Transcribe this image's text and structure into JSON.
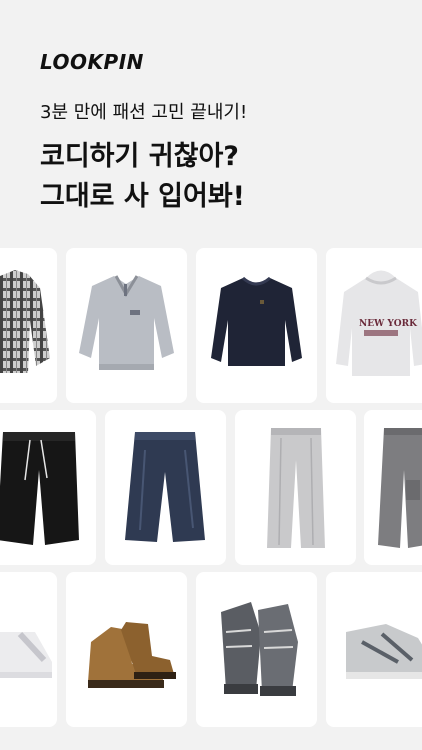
{
  "app": {
    "logo": "LOOKPIN",
    "subline": "3분 만에 패션 고민 끝내기!",
    "headline_line1": "코디하기 귀찮아?",
    "headline_line2": "그대로 사 입어봐!"
  },
  "rows": [
    {
      "name": "tops",
      "items": [
        {
          "icon": "plaid-shirt-icon"
        },
        {
          "icon": "grey-sweatshirt-icon"
        },
        {
          "icon": "navy-sweater-icon"
        },
        {
          "icon": "hoodie-icon",
          "print": "NEW YORK"
        }
      ]
    },
    {
      "name": "bottoms",
      "items": [
        {
          "icon": "black-pants-icon"
        },
        {
          "icon": "denim-pants-icon"
        },
        {
          "icon": "grey-slacks-icon"
        },
        {
          "icon": "cargo-pants-icon"
        }
      ]
    },
    {
      "name": "shoes",
      "items": [
        {
          "icon": "white-sneaker-icon"
        },
        {
          "icon": "brown-boots-icon"
        },
        {
          "icon": "grey-chunky-sneakers-icon"
        },
        {
          "icon": "silver-runner-icon"
        }
      ]
    }
  ],
  "colors": {
    "background": "#f2f2f2",
    "card": "#ffffff",
    "text": "#111111"
  }
}
